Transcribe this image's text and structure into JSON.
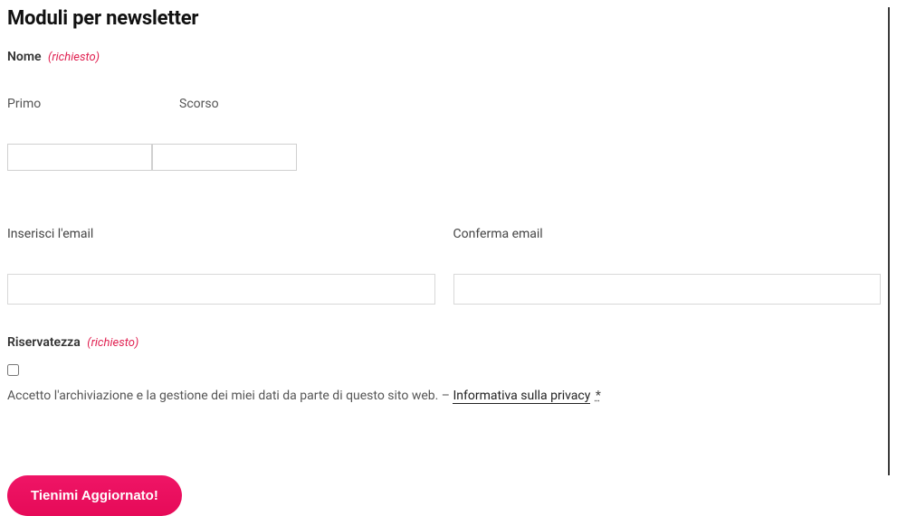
{
  "title": "Moduli per newsletter",
  "name": {
    "group_label": "Nome",
    "required_text": "(richiesto)",
    "first_label": "Primo",
    "last_label": "Scorso",
    "first_value": "",
    "last_value": ""
  },
  "email": {
    "enter_label": "Inserisci l'email",
    "confirm_label": "Conferma email",
    "enter_value": "",
    "confirm_value": ""
  },
  "privacy": {
    "group_label": "Riservatezza",
    "required_text": "(richiesto)",
    "checkbox_checked": false,
    "consent_text": "Accetto l'archiviazione e la gestione dei miei dati da parte di questo sito web. – ",
    "link_text": "Informativa sulla privacy",
    "star": "*"
  },
  "submit": {
    "label": "Tienimi Aggiornato!"
  },
  "colors": {
    "accent": "#ea0c5f",
    "required": "#e02050"
  }
}
